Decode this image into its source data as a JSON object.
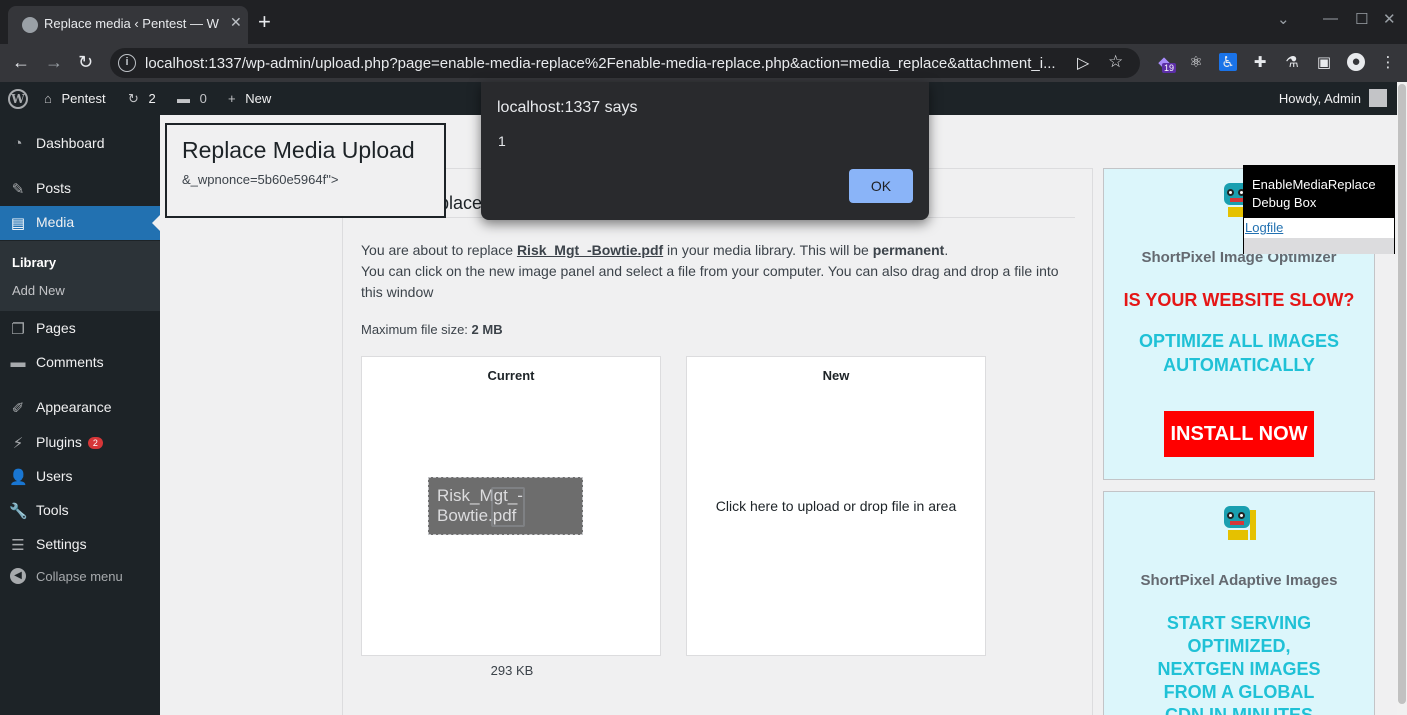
{
  "browser": {
    "tab_title": "Replace media ‹ Pentest — W",
    "tab_close": "✕",
    "new_tab": "+",
    "url": "localhost:1337/wp-admin/upload.php?page=enable-media-replace%2Fenable-media-replace.php&action=media_replace&attachment_i...",
    "extension_badge": "19"
  },
  "adminbar": {
    "site_name": "Pentest",
    "updates_count": "2",
    "comments_count": "0",
    "new_label": "New",
    "howdy": "Howdy, Admin"
  },
  "sidebar": {
    "items": [
      {
        "label": "Dashboard",
        "icon": "dashboard-icon"
      },
      {
        "label": "Posts",
        "icon": "pin-icon"
      },
      {
        "label": "Media",
        "icon": "media-icon"
      },
      {
        "label": "Pages",
        "icon": "pages-icon"
      },
      {
        "label": "Comments",
        "icon": "comment-icon"
      },
      {
        "label": "Appearance",
        "icon": "brush-icon"
      },
      {
        "label": "Plugins",
        "icon": "plugin-icon"
      },
      {
        "label": "Users",
        "icon": "user-icon"
      },
      {
        "label": "Tools",
        "icon": "wrench-icon"
      },
      {
        "label": "Settings",
        "icon": "settings-icon"
      }
    ],
    "submenu": [
      "Library",
      "Add New"
    ],
    "plugins_badge": "2",
    "collapse": "Collapse menu"
  },
  "main": {
    "title": "Replace Media Upload",
    "nonce_text": "&_wpnonce=5b60e5964f\">",
    "section_title": "Select Replacement Media",
    "desc_prefix": "You are about to replace ",
    "file_name": "Risk_Mgt_-Bowtie.pdf",
    "desc_middle": " in your media library. This will be ",
    "desc_bold": "permanent",
    "desc_end": ".",
    "desc_line2": "You can click on the new image panel and select a file from your computer. You can also drag and drop a file into this window",
    "max_label": "Maximum file size: ",
    "max_value": "2 MB",
    "current_label": "Current",
    "new_label": "New",
    "current_file": "Risk_Mgt_-Bowtie.pdf",
    "upload_text": "Click here to upload or drop file in area",
    "file_size": "293 KB"
  },
  "ads": {
    "ad1_name": "ShortPixel Image Optimizer",
    "ad1_headline": "IS YOUR WEBSITE SLOW?",
    "ad1_sub": "OPTIMIZE ALL IMAGES AUTOMATICALLY",
    "ad1_button": "INSTALL NOW",
    "ad2_name": "ShortPixel Adaptive Images",
    "ad2_sub": "START SERVING OPTIMIZED, NEXTGEN IMAGES FROM A GLOBAL CDN IN MINUTES"
  },
  "debug": {
    "title": "EnableMediaReplace Debug Box",
    "link": "Logfile"
  },
  "dialog": {
    "title": "localhost:1337 says",
    "message": "1",
    "ok": "OK"
  },
  "colors": {
    "accent": "#2271b1",
    "admin_dark": "#1d2327",
    "ad_bg": "#dcf6fb",
    "ad_red": "#e51616",
    "ad_cyan": "#1fc1d6"
  }
}
